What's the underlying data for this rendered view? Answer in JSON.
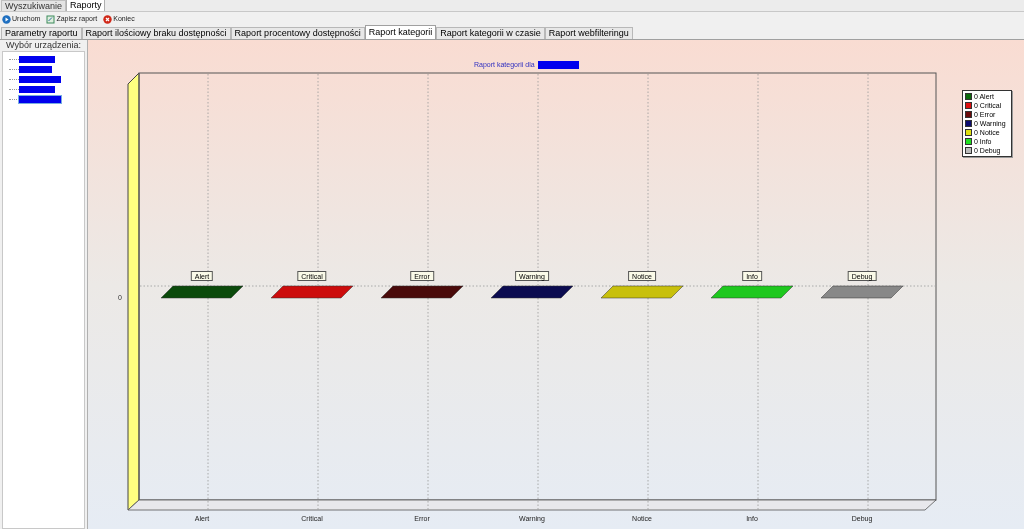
{
  "top_tabs": [
    {
      "label": "Wyszukiwanie",
      "selected": false
    },
    {
      "label": "Raporty",
      "selected": true
    }
  ],
  "toolbar": [
    {
      "label": "Uruchom",
      "kind": "run"
    },
    {
      "label": "Zapisz raport",
      "kind": "save"
    },
    {
      "label": "Koniec",
      "kind": "close"
    }
  ],
  "report_tabs": [
    {
      "label": "Parametry raportu",
      "selected": false
    },
    {
      "label": "Raport ilościowy braku dostępności",
      "selected": false
    },
    {
      "label": "Raport procentowy dostępności",
      "selected": false
    },
    {
      "label": "Raport kategorii",
      "selected": true
    },
    {
      "label": "Raport kategorii w czasie",
      "selected": false
    },
    {
      "label": "Raport webfilteringu",
      "selected": false
    }
  ],
  "device_panel": {
    "title": "Wybór urządzenia:",
    "items": [
      {
        "selected": false
      },
      {
        "selected": false
      },
      {
        "selected": false
      },
      {
        "selected": false
      },
      {
        "selected": true
      }
    ]
  },
  "chart": {
    "title": "Raport kategorii dla",
    "y_axis_label": "0",
    "categories": [
      {
        "label": "Alert",
        "bar_label": "Alert",
        "color": "#0b4a0b"
      },
      {
        "label": "Critical",
        "bar_label": "Critical",
        "color": "#cc0c0c"
      },
      {
        "label": "Error",
        "bar_label": "Error",
        "color": "#4a0a0a"
      },
      {
        "label": "Warning",
        "bar_label": "Warning",
        "color": "#0b0b50"
      },
      {
        "label": "Notice",
        "bar_label": "Notice",
        "color": "#c8c00c"
      },
      {
        "label": "Info",
        "bar_label": "Info",
        "color": "#1ec81e"
      },
      {
        "label": "Debug",
        "bar_label": "Debug",
        "color": "#888888"
      }
    ],
    "legend": [
      {
        "label": "0 Alert",
        "color": "#0b6a0b"
      },
      {
        "label": "0 Critical",
        "color": "#dd1010"
      },
      {
        "label": "0 Error",
        "color": "#6a0a0a"
      },
      {
        "label": "0 Warning",
        "color": "#0b0b70"
      },
      {
        "label": "0 Notice",
        "color": "#e0e010"
      },
      {
        "label": "0 Info",
        "color": "#20e020"
      },
      {
        "label": "0 Debug",
        "color": "#bbbbbb"
      }
    ]
  }
}
